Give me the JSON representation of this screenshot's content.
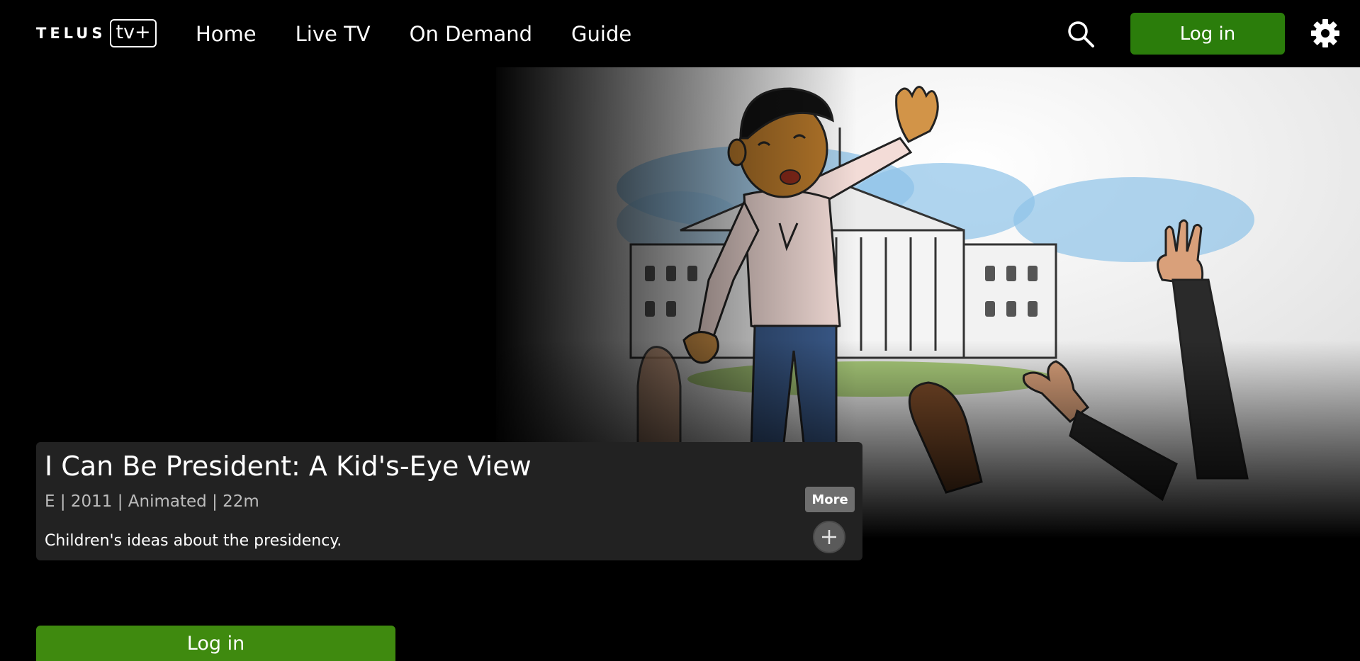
{
  "brand": {
    "wordmark": "TELUS",
    "product": "tv+"
  },
  "nav": {
    "items": [
      {
        "label": "Home"
      },
      {
        "label": "Live TV"
      },
      {
        "label": "On Demand"
      },
      {
        "label": "Guide"
      }
    ]
  },
  "header": {
    "search_icon": "search-icon",
    "login_label": "Log in",
    "settings_icon": "gear-icon"
  },
  "feature": {
    "title": "I Can Be President: A Kid's-Eye View",
    "meta": "E | 2011 | Animated | 22m",
    "description": "Children's ideas about the presidency.",
    "more_label": "More",
    "add_icon": "plus-icon"
  },
  "footer": {
    "login_label": "Log in"
  },
  "colors": {
    "background": "#000000",
    "card": "#222222",
    "login_green": "#2b7d0b",
    "login_green_bottom": "#3f8a0f"
  }
}
